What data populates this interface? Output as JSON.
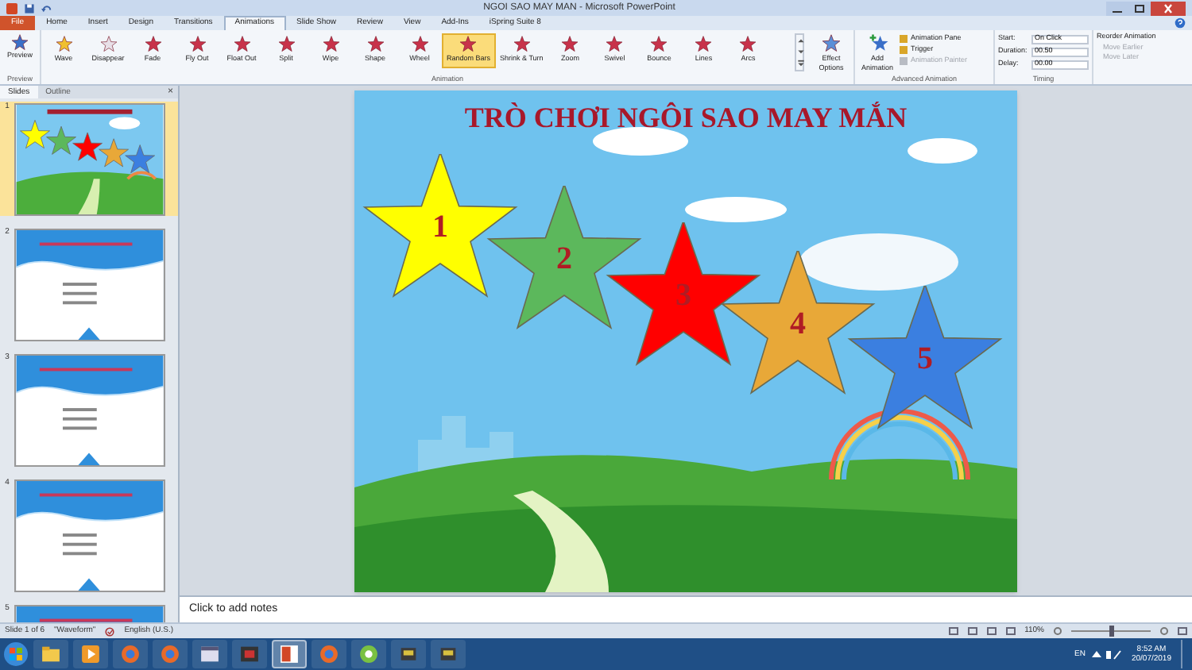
{
  "window": {
    "title": "NGOI SAO MAY MAN - Microsoft PowerPoint"
  },
  "tabs": [
    {
      "label": "File",
      "selected": false,
      "kind": "file"
    },
    {
      "label": "Home",
      "selected": false,
      "kind": "tab"
    },
    {
      "label": "Insert",
      "selected": false,
      "kind": "tab"
    },
    {
      "label": "Design",
      "selected": false,
      "kind": "tab"
    },
    {
      "label": "Transitions",
      "selected": false,
      "kind": "tab"
    },
    {
      "label": "Animations",
      "selected": true,
      "kind": "tab"
    },
    {
      "label": "Slide Show",
      "selected": false,
      "kind": "tab"
    },
    {
      "label": "Review",
      "selected": false,
      "kind": "tab"
    },
    {
      "label": "View",
      "selected": false,
      "kind": "tab"
    },
    {
      "label": "Add-Ins",
      "selected": false,
      "kind": "tab"
    },
    {
      "label": "iSpring Suite 8",
      "selected": false,
      "kind": "tab"
    }
  ],
  "ribbon": {
    "preview": {
      "label": "Preview",
      "group": "Preview"
    },
    "animations": [
      {
        "label": "Wave",
        "selected": false
      },
      {
        "label": "Disappear",
        "selected": false
      },
      {
        "label": "Fade",
        "selected": false
      },
      {
        "label": "Fly Out",
        "selected": false
      },
      {
        "label": "Float Out",
        "selected": false
      },
      {
        "label": "Split",
        "selected": false
      },
      {
        "label": "Wipe",
        "selected": false
      },
      {
        "label": "Shape",
        "selected": false
      },
      {
        "label": "Wheel",
        "selected": false
      },
      {
        "label": "Random Bars",
        "selected": true
      },
      {
        "label": "Shrink & Turn",
        "selected": false
      },
      {
        "label": "Zoom",
        "selected": false
      },
      {
        "label": "Swivel",
        "selected": false
      },
      {
        "label": "Bounce",
        "selected": false
      },
      {
        "label": "Lines",
        "selected": false
      },
      {
        "label": "Arcs",
        "selected": false
      }
    ],
    "animation_group": "Animation",
    "effect_options": "Effect Options",
    "add_animation": "Add Animation",
    "advanced": [
      {
        "label": "Animation Pane",
        "disabled": false
      },
      {
        "label": "Trigger",
        "disabled": false
      },
      {
        "label": "Animation Painter",
        "disabled": true
      }
    ],
    "advanced_group": "Advanced Animation",
    "timing": {
      "start_label": "Start:",
      "start_value": "On Click",
      "duration_label": "Duration:",
      "duration_value": "00.50",
      "delay_label": "Delay:",
      "delay_value": "00.00",
      "group": "Timing"
    },
    "reorder": {
      "title": "Reorder Animation",
      "items": [
        {
          "label": "Move Earlier",
          "disabled": true
        },
        {
          "label": "Move Later",
          "disabled": true
        }
      ]
    }
  },
  "panel": {
    "tabs": [
      {
        "label": "Slides",
        "selected": true
      },
      {
        "label": "Outline",
        "selected": false
      }
    ],
    "close": "×",
    "slides": [
      {
        "number": "1",
        "kind": "title",
        "selected": true
      },
      {
        "number": "2",
        "kind": "quiz",
        "selected": false
      },
      {
        "number": "3",
        "kind": "quiz",
        "selected": false
      },
      {
        "number": "4",
        "kind": "quiz",
        "selected": false
      },
      {
        "number": "5",
        "kind": "quiz",
        "selected": false
      }
    ]
  },
  "slide": {
    "title": "TRÒ CHƠI NGÔI SAO MAY MẮN",
    "stars": [
      {
        "number": "1",
        "color": "#ffff00"
      },
      {
        "number": "2",
        "color": "#5cb85c"
      },
      {
        "number": "3",
        "color": "#ff0000"
      },
      {
        "number": "4",
        "color": "#e8a838"
      },
      {
        "number": "5",
        "color": "#3b7fe0"
      }
    ]
  },
  "notes": {
    "placeholder": "Click to add notes"
  },
  "status_bar": {
    "slide": "Slide 1 of 6",
    "theme": "\"Waveform\"",
    "language": "English (U.S.)",
    "zoom": "110%",
    "zoom_slider": {
      "level": 0.5
    }
  },
  "taskbar": {
    "apps": [
      {
        "kind": "folder",
        "selected": false
      },
      {
        "kind": "media",
        "selected": false
      },
      {
        "kind": "globe",
        "selected": false
      },
      {
        "kind": "globe",
        "selected": false
      },
      {
        "kind": "window",
        "selected": false
      },
      {
        "kind": "film",
        "selected": false
      },
      {
        "kind": "slides",
        "selected": true
      },
      {
        "kind": "globe",
        "selected": false
      },
      {
        "kind": "circle",
        "selected": false
      },
      {
        "kind": "box",
        "selected": false
      },
      {
        "kind": "box",
        "selected": false
      }
    ],
    "language": "EN",
    "time": "8:52 AM",
    "date": "20/07/2019"
  }
}
